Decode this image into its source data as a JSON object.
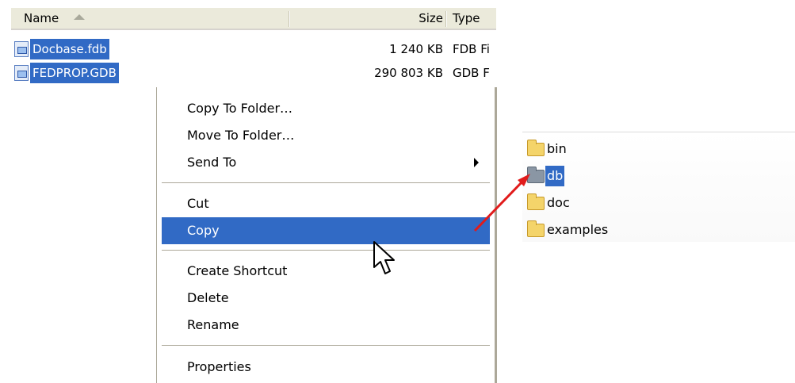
{
  "columns": {
    "name": "Name",
    "size": "Size",
    "type": "Type"
  },
  "files": [
    {
      "name": "Docbase.fdb",
      "size": "1 240 KB",
      "type": "FDB Fi",
      "icon": "database-file-icon"
    },
    {
      "name": "FEDPROP.GDB",
      "size": "290 803 KB",
      "type": "GDB F",
      "icon": "database-file-icon"
    }
  ],
  "context_menu": {
    "items": [
      "Copy To Folder…",
      "Move To Folder…",
      "Send To",
      "Cut",
      "Copy",
      "Create Shortcut",
      "Delete",
      "Rename",
      "Properties"
    ],
    "highlighted": "Copy",
    "submenu_item": "Send To"
  },
  "folders": [
    {
      "name": "bin",
      "icon": "folder-icon"
    },
    {
      "name": "db",
      "icon": "folder-icon",
      "selected": true
    },
    {
      "name": "doc",
      "icon": "folder-icon"
    },
    {
      "name": "examples",
      "icon": "folder-icon"
    }
  ],
  "colors": {
    "selection": "#316ac5",
    "header_bg": "#ebeadb",
    "menu_border": "#aca899",
    "folder_yellow": "#f4d46a",
    "annotation_arrow": "#e11b1b"
  }
}
